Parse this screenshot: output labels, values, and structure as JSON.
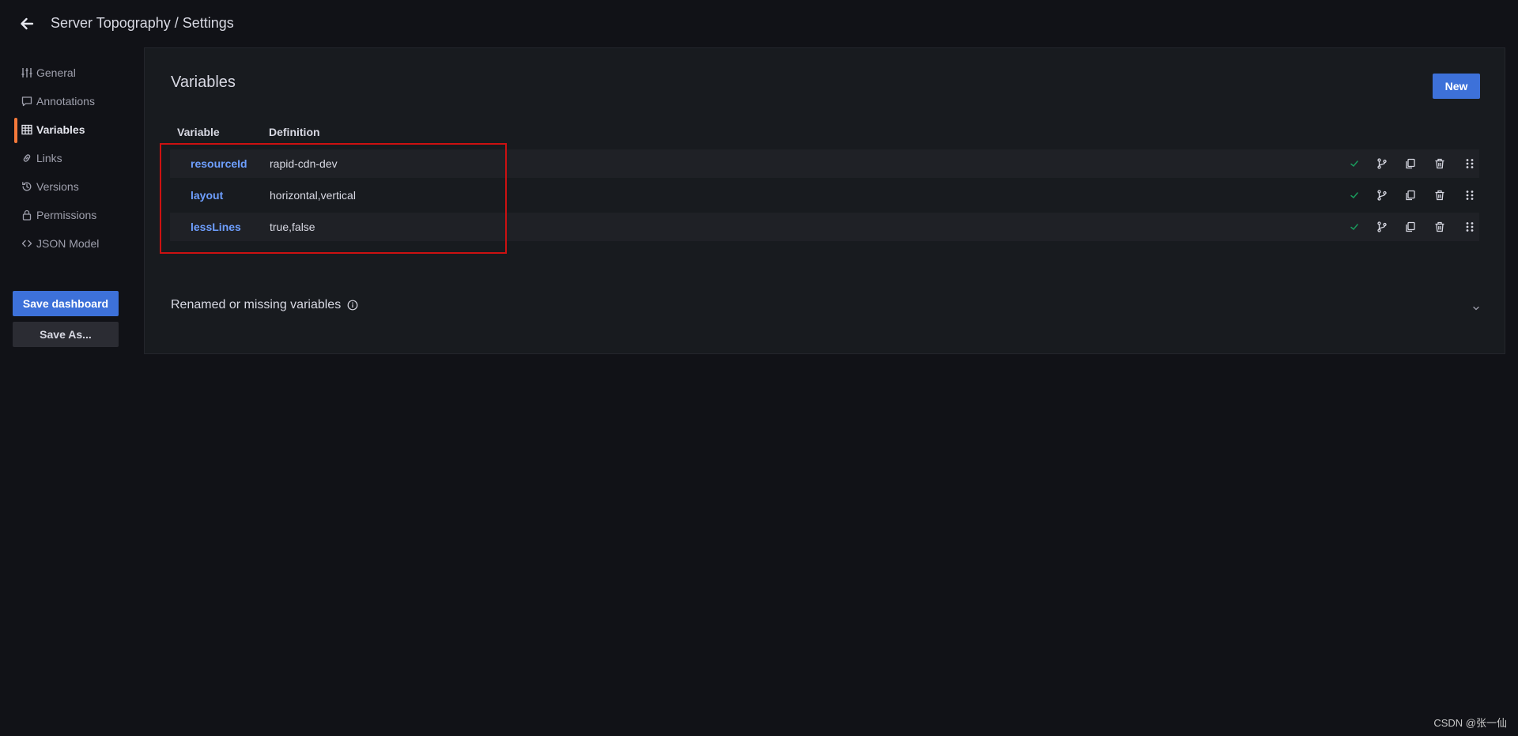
{
  "header": {
    "back_icon": "arrow-left-icon",
    "title": "Server Topography / Settings"
  },
  "sidebar": {
    "items": [
      {
        "label": "General",
        "icon": "sliders-icon",
        "active": false
      },
      {
        "label": "Annotations",
        "icon": "comment-icon",
        "active": false
      },
      {
        "label": "Variables",
        "icon": "table-icon",
        "active": true
      },
      {
        "label": "Links",
        "icon": "link-icon",
        "active": false
      },
      {
        "label": "Versions",
        "icon": "history-icon",
        "active": false
      },
      {
        "label": "Permissions",
        "icon": "lock-icon",
        "active": false
      },
      {
        "label": "JSON Model",
        "icon": "code-icon",
        "active": false
      }
    ],
    "save_label": "Save dashboard",
    "save_as_label": "Save As..."
  },
  "main": {
    "title": "Variables",
    "new_label": "New",
    "columns": {
      "variable": "Variable",
      "definition": "Definition"
    },
    "rows": [
      {
        "name": "resourceId",
        "definition": "rapid-cdn-dev"
      },
      {
        "name": "layout",
        "definition": "horizontal,vertical"
      },
      {
        "name": "lessLines",
        "definition": "true,false"
      }
    ],
    "renamed_label": "Renamed or missing variables"
  },
  "watermark": "CSDN @张一仙",
  "colors": {
    "background": "#111217",
    "panel": "#181b1f",
    "accent": "#3d71d9",
    "active_indicator": "#f5793a",
    "link": "#6e9fff",
    "check": "#1a9a5c",
    "highlight": "#cc1111"
  }
}
